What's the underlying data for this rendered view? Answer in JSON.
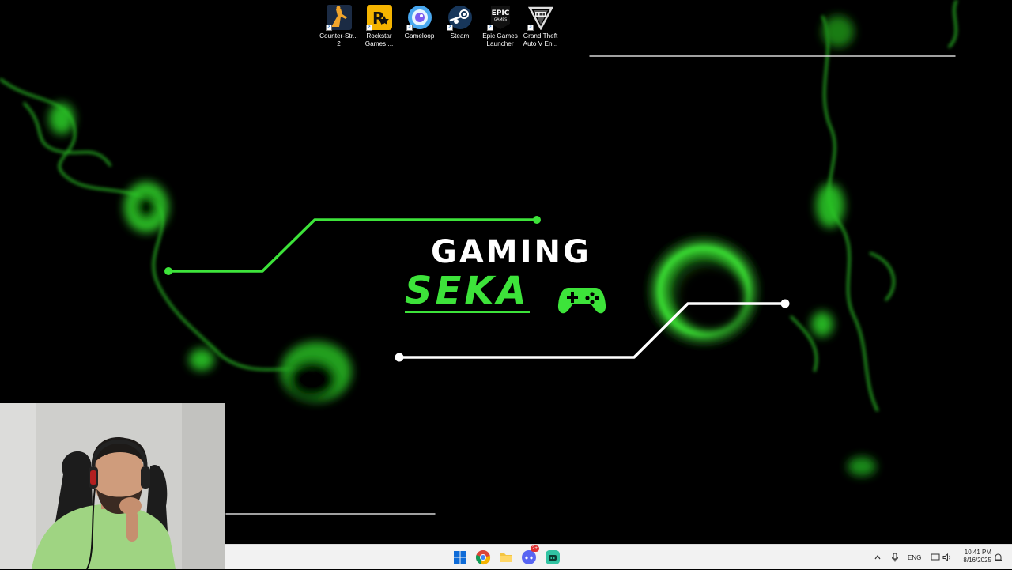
{
  "desktop_icons": [
    {
      "label": "Counter-Str...\n2",
      "icon": "counter-strike-2-icon"
    },
    {
      "label": "Rockstar\nGames ...",
      "icon": "rockstar-games-icon"
    },
    {
      "label": "Gameloop",
      "icon": "gameloop-icon"
    },
    {
      "label": "Steam",
      "icon": "steam-icon"
    },
    {
      "label": "Epic Games\nLauncher",
      "icon": "epic-games-icon"
    },
    {
      "label": "Grand Theft\nAuto V En...",
      "icon": "gta-v-icon"
    }
  ],
  "epic_logo_text": "EPIC",
  "epic_logo_sub": "GAMES",
  "wallpaper": {
    "line1": "GAMING",
    "line2": "SEKA",
    "accent": "#3de33a"
  },
  "taskbar": {
    "apps": [
      "windows-start-icon",
      "chrome-icon",
      "file-explorer-icon",
      "discord-icon",
      "streamlabs-icon"
    ],
    "discord_badge": "2+"
  },
  "tray": {
    "language": "ENG",
    "time": "10:41 PM",
    "date": "8/16/2025"
  },
  "colors": {
    "accent_green": "#3de33a",
    "taskbar_bg": "#f2f2f2"
  }
}
